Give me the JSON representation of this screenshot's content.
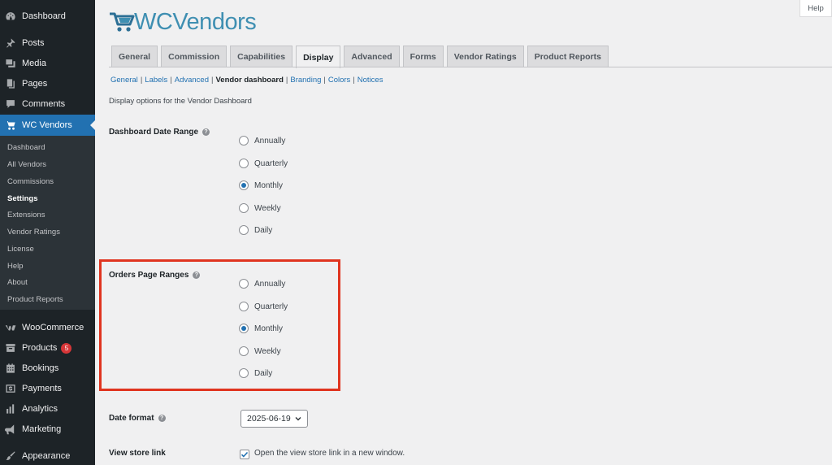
{
  "sidebar": {
    "top_items": [
      {
        "label": "Dashboard",
        "icon": "dashboard-icon"
      },
      {
        "label": "Posts",
        "icon": "pin-icon"
      },
      {
        "label": "Media",
        "icon": "media-icon"
      },
      {
        "label": "Pages",
        "icon": "pages-icon"
      },
      {
        "label": "Comments",
        "icon": "comment-icon"
      },
      {
        "label": "WC Vendors",
        "icon": "cart-icon"
      }
    ],
    "submenu": [
      "Dashboard",
      "All Vendors",
      "Commissions",
      "Settings",
      "Extensions",
      "Vendor Ratings",
      "License",
      "Help",
      "About",
      "Product Reports"
    ],
    "bottom_items": [
      {
        "label": "WooCommerce",
        "icon": "woo-icon"
      },
      {
        "label": "Products",
        "icon": "archive-icon",
        "badge": "5"
      },
      {
        "label": "Bookings",
        "icon": "calendar-icon"
      },
      {
        "label": "Payments",
        "icon": "payments-icon"
      },
      {
        "label": "Analytics",
        "icon": "chart-icon"
      },
      {
        "label": "Marketing",
        "icon": "megaphone-icon"
      },
      {
        "label": "Appearance",
        "icon": "brush-icon"
      }
    ]
  },
  "help_label": "Help",
  "logo_text": "WCVendors",
  "tabs": [
    "General",
    "Commission",
    "Capabilities",
    "Display",
    "Advanced",
    "Forms",
    "Vendor Ratings",
    "Product Reports"
  ],
  "subsub": [
    "General",
    "Labels",
    "Advanced",
    "Vendor dashboard",
    "Branding",
    "Colors",
    "Notices"
  ],
  "description": "Display options for the Vendor Dashboard",
  "dashboard_range": {
    "label": "Dashboard Date Range",
    "options": [
      "Annually",
      "Quarterly",
      "Monthly",
      "Weekly",
      "Daily"
    ],
    "selected": "Monthly"
  },
  "orders_range": {
    "label": "Orders Page Ranges",
    "options": [
      "Annually",
      "Quarterly",
      "Monthly",
      "Weekly",
      "Daily"
    ],
    "selected": "Monthly"
  },
  "date_format": {
    "label": "Date format",
    "value": "2025-06-19"
  },
  "store_link": {
    "label": "View store link",
    "checkbox_label": "Open the view store link in a new window.",
    "checked": true
  },
  "colors": {
    "accent": "#2271b1",
    "sidebar": "#1d2327",
    "highlight": "#e0341f"
  }
}
